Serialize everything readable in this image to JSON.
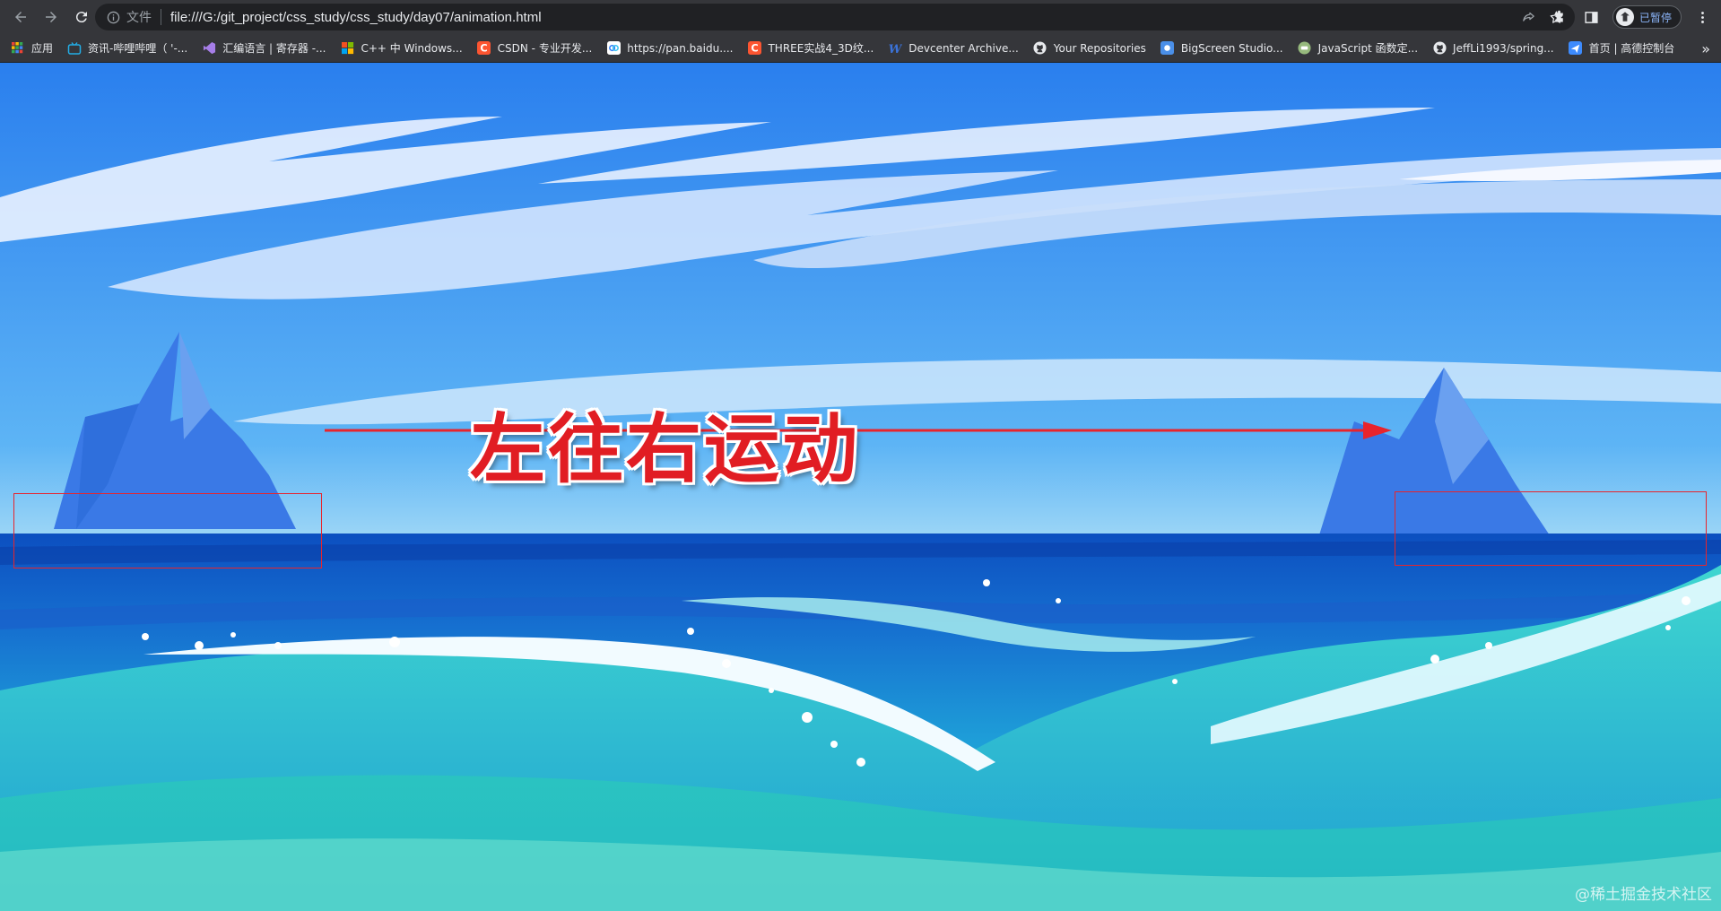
{
  "browser": {
    "url_scheme_label": "文件",
    "url": "file:///G:/git_project/css_study/css_study/day07/animation.html",
    "profile_status": "已暂停",
    "nav_icons": [
      "back-icon",
      "forward-icon",
      "reload-icon"
    ],
    "omnibox_icons": [
      "share-icon",
      "star-icon"
    ],
    "toolbar_icons": [
      "extensions-icon",
      "side-panel-icon",
      "menu-icon"
    ]
  },
  "bookmarks": [
    {
      "label": "应用",
      "icon": "apps-grid-icon",
      "color": "#e8eaed"
    },
    {
      "label": "资讯-哔哩哔哩（ '-...",
      "icon": "bilibili-icon",
      "color": "#23ade5"
    },
    {
      "label": "汇编语言 | 寄存器 -...",
      "icon": "visual-studio-icon",
      "color": "#a67ee8"
    },
    {
      "label": "C++ 中 Windows...",
      "icon": "microsoft-icon",
      "color": "#f25022"
    },
    {
      "label": "CSDN - 专业开发...",
      "icon": "csdn-icon",
      "color": "#fc5531"
    },
    {
      "label": "https://pan.baidu....",
      "icon": "baidu-pan-icon",
      "color": "#2e7bf6"
    },
    {
      "label": "THREE实战4_3D纹...",
      "icon": "csdn-icon",
      "color": "#fc5531"
    },
    {
      "label": "Devcenter Archive...",
      "icon": "w-icon",
      "color": "#3b73d9"
    },
    {
      "label": "Your Repositories",
      "icon": "github-icon",
      "color": "#e8eaed"
    },
    {
      "label": "BigScreen Studio...",
      "icon": "bigscreen-icon",
      "color": "#4a8fe8"
    },
    {
      "label": "JavaScript 函数定...",
      "icon": "runoob-icon",
      "color": "#96b97d"
    },
    {
      "label": "JeffLi1993/spring...",
      "icon": "github-icon",
      "color": "#e8eaed"
    },
    {
      "label": "首页 | 高德控制台",
      "icon": "amap-icon",
      "color": "#3d8bfd"
    }
  ],
  "bookmarks_overflow": "»",
  "page": {
    "annotation_text": "左往右运动",
    "watermark": "@稀土掘金技术社区",
    "colors": {
      "annotation": "#e11d23",
      "sky_top": "#2f8af0",
      "sea": "#1677d2"
    }
  }
}
